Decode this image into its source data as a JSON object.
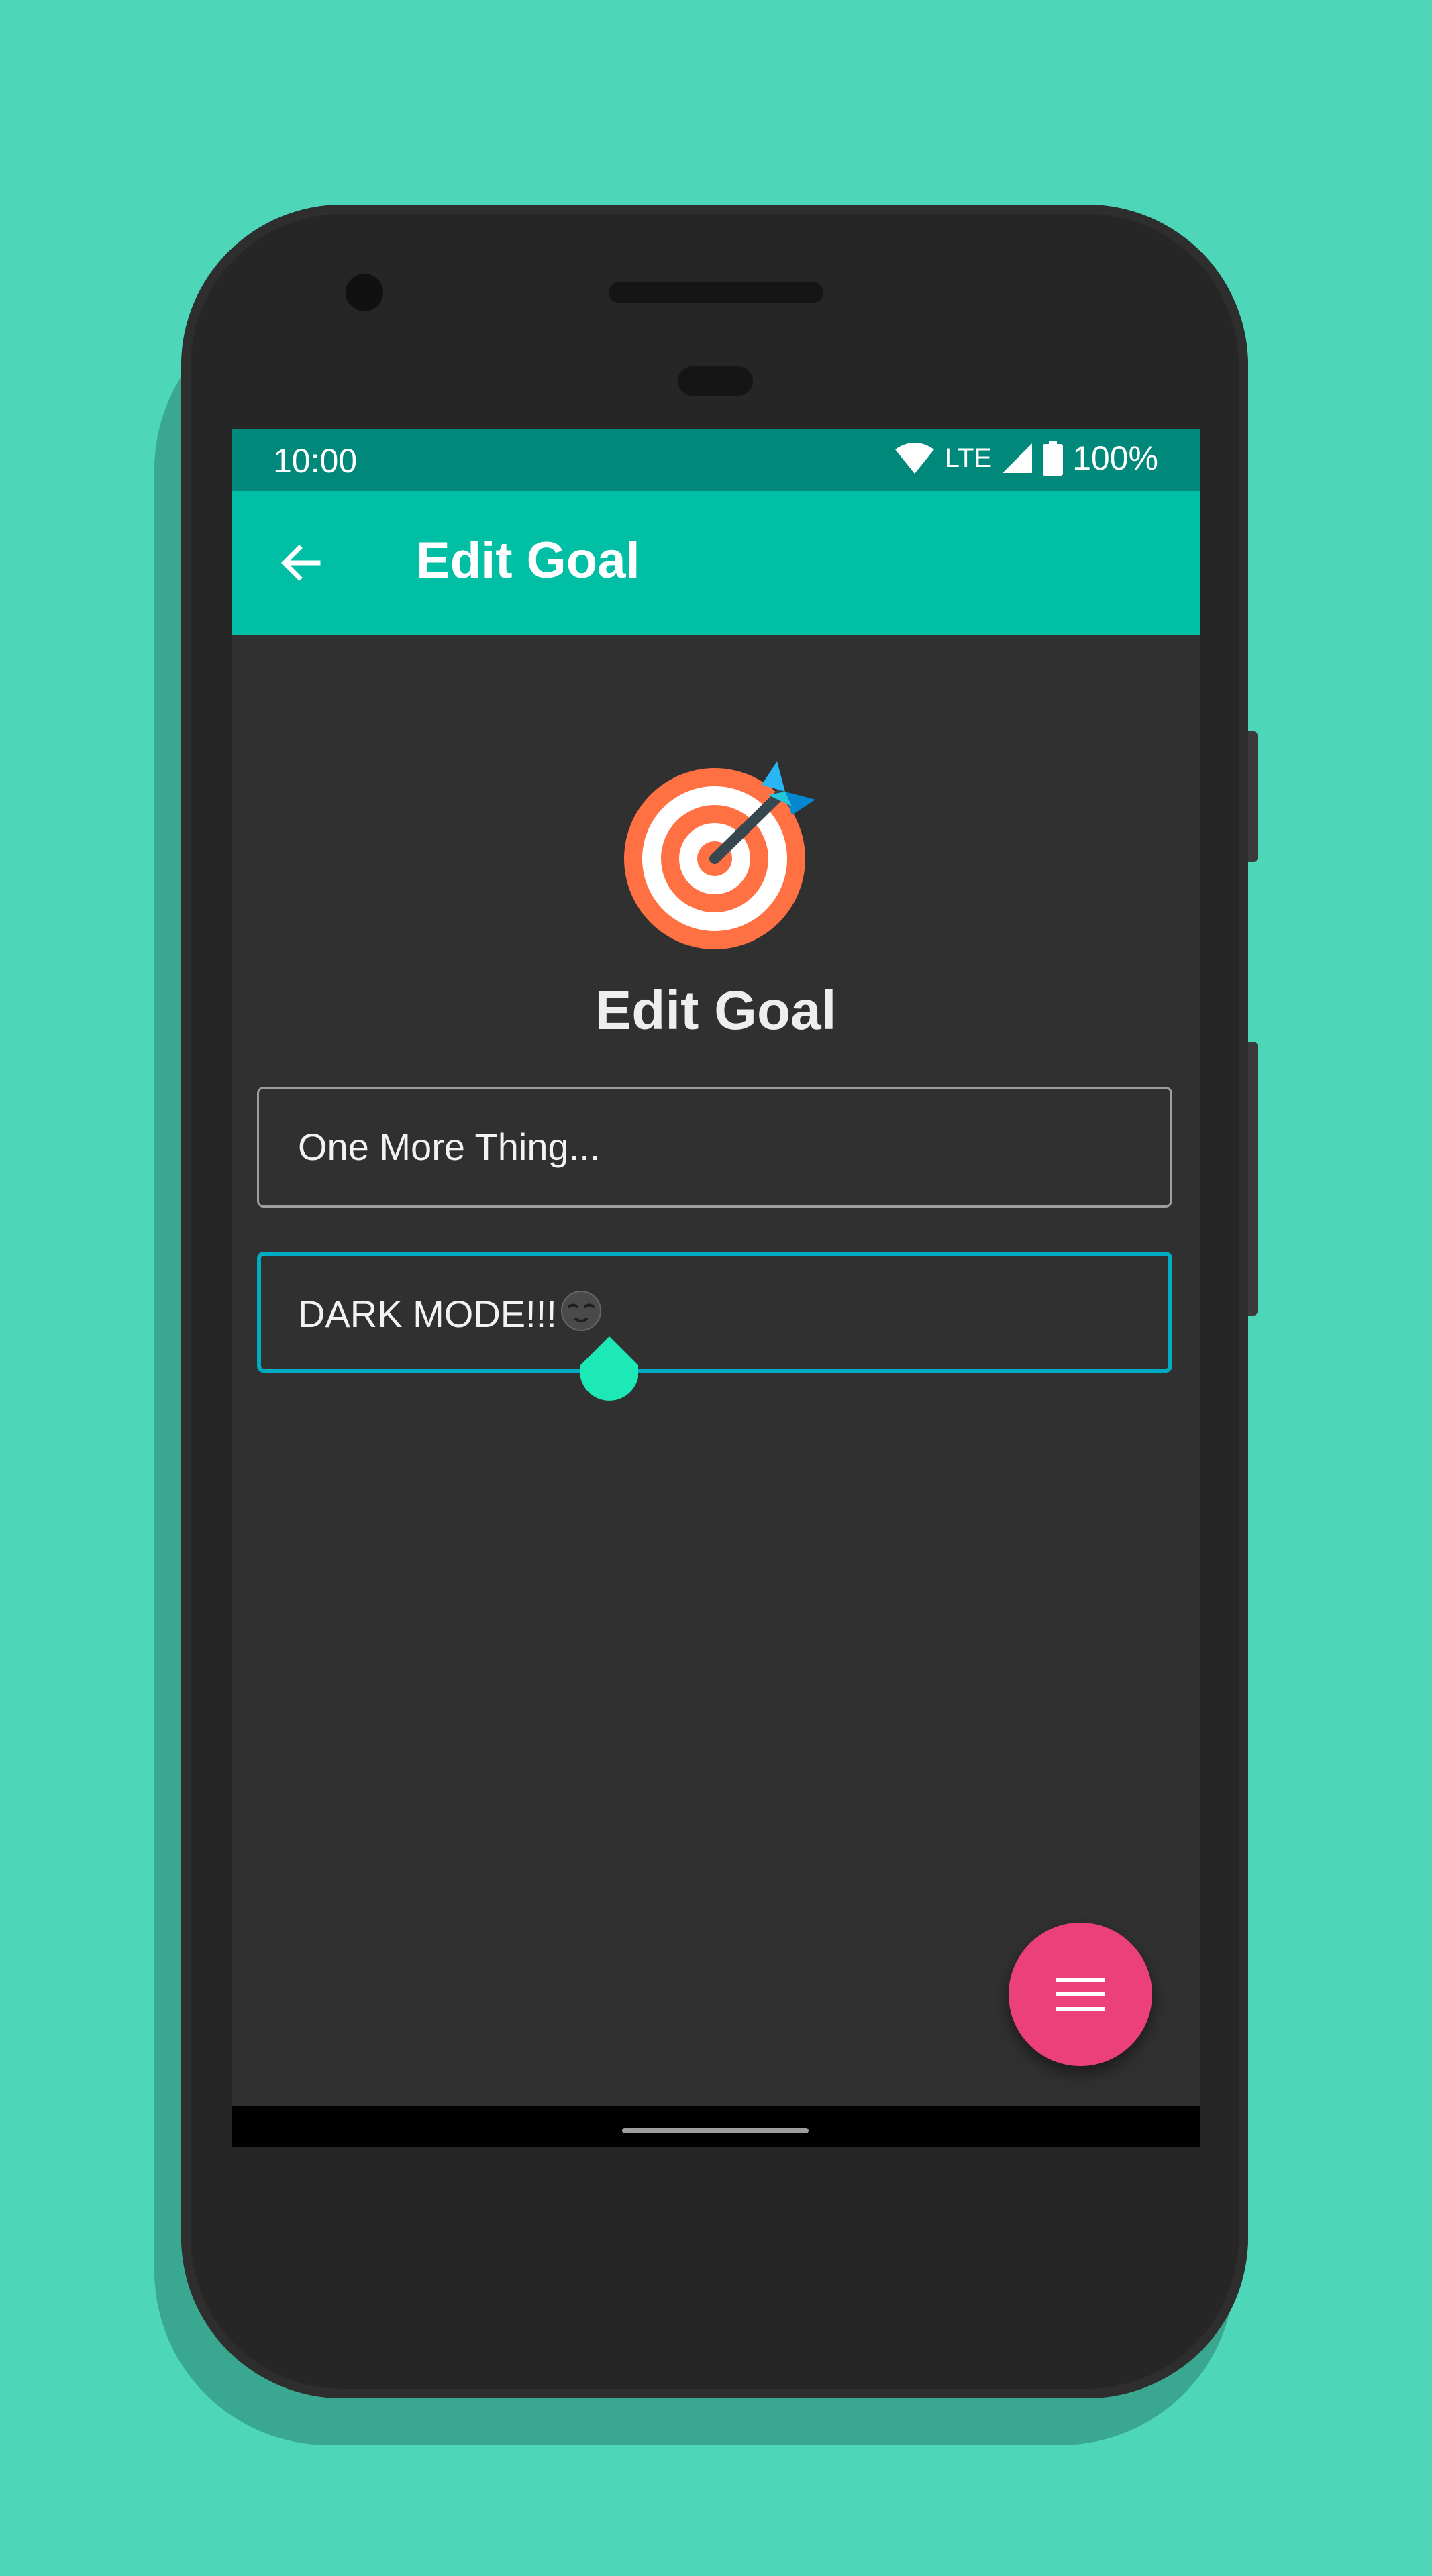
{
  "status_bar": {
    "time": "10:00",
    "network": "LTE",
    "battery": "100%"
  },
  "app_bar": {
    "title": "Edit Goal",
    "back_icon": "arrow-back-icon"
  },
  "content": {
    "hero_icon": "target-dart-icon",
    "heading": "Edit Goal",
    "title_field": {
      "value": "One More Thing..."
    },
    "description_field": {
      "value": "DARK MODE!!!",
      "emoji": "new-moon-face-icon"
    }
  },
  "fab": {
    "icon": "menu-icon"
  },
  "colors": {
    "status_bar": "#00897b",
    "app_bar": "#00bfa5",
    "background": "#303030",
    "focused_border": "#00acc1",
    "cursor_handle": "#1de9b6",
    "fab": "#ec407a",
    "page": "#4dd6b8"
  }
}
